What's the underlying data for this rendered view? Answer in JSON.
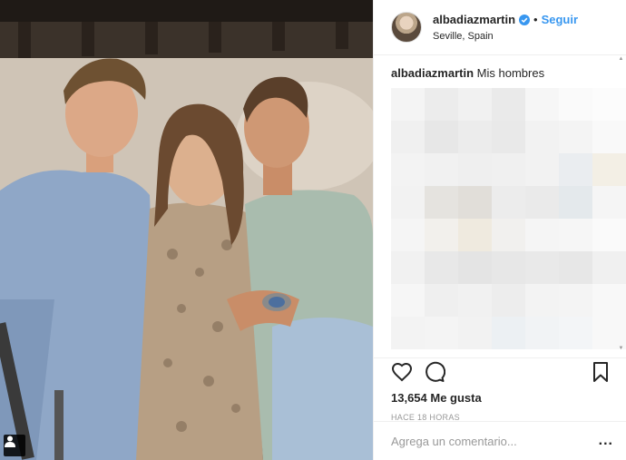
{
  "post": {
    "username": "albadiazmartin",
    "follow_label": "Seguir",
    "separator": "•",
    "location": "Seville, Spain",
    "caption_user": "albadiazmartin",
    "caption_text": "Mis hombres",
    "likes": "13,654 Me gusta",
    "time": "HACE 18 HORAS",
    "comment_placeholder": "Agrega un comentario...",
    "more_label": "..."
  },
  "icons": {
    "verified": "verified-badge-icon",
    "like": "heart-icon",
    "comment": "comment-icon",
    "save": "bookmark-icon",
    "tag": "user-tag-icon"
  },
  "colors": {
    "follow": "#3897f0",
    "text": "#262626",
    "muted": "#999999",
    "divider": "#efefef"
  }
}
